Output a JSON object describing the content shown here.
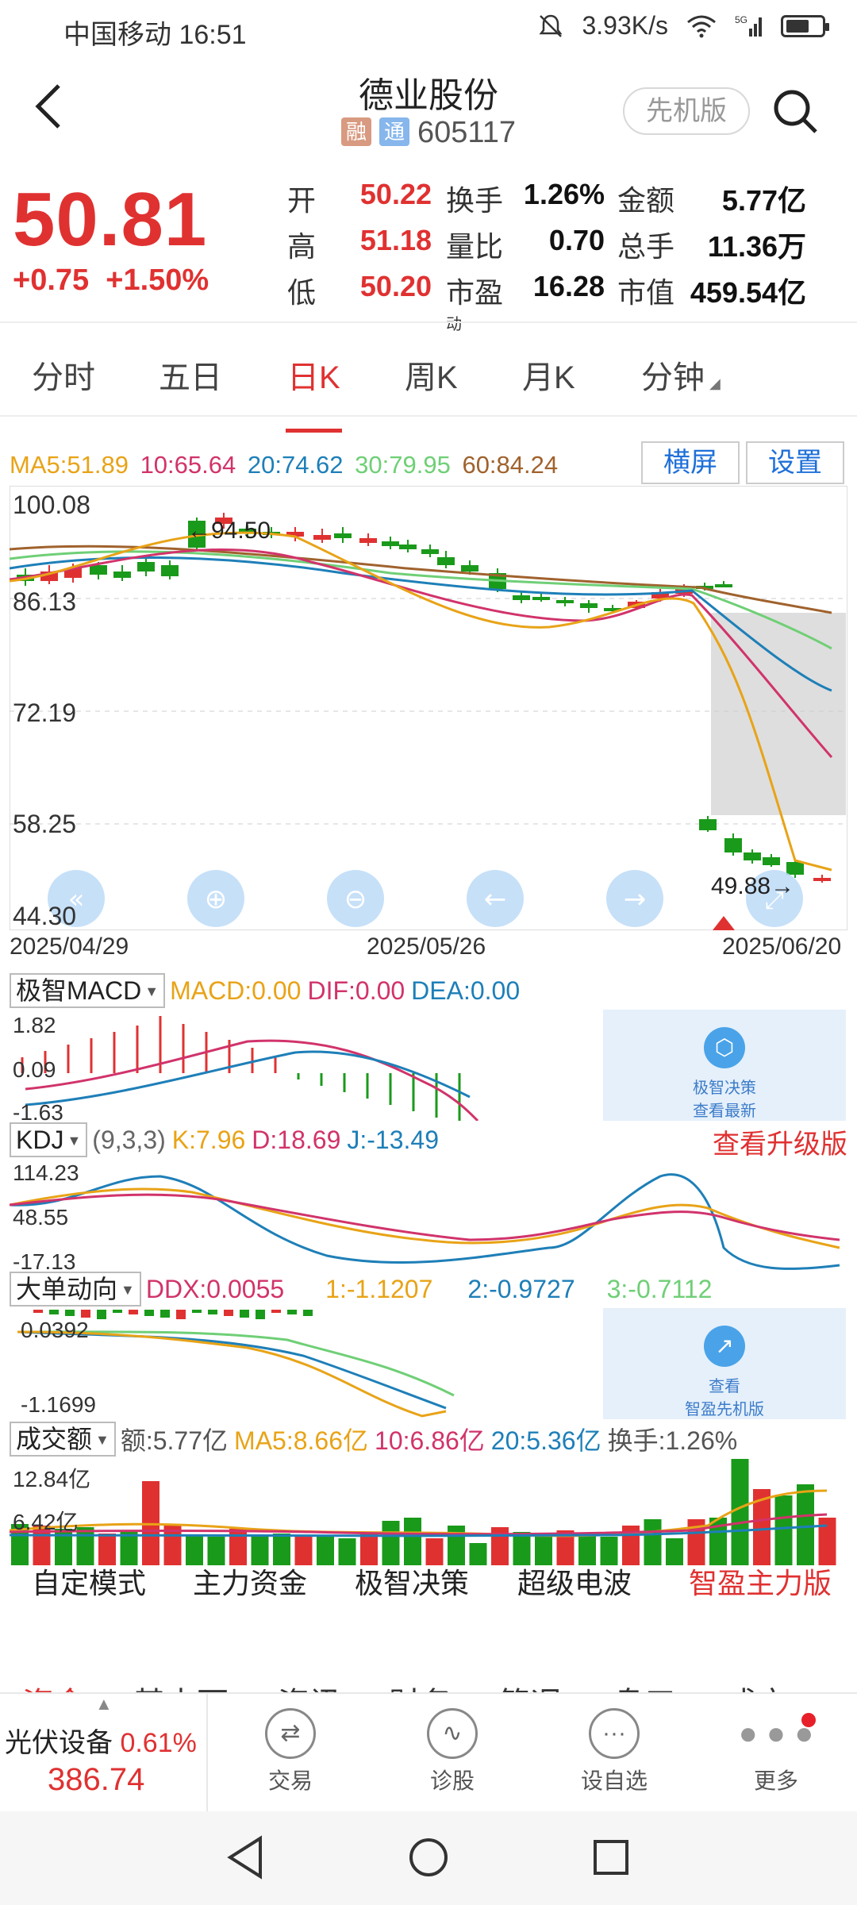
{
  "status": {
    "carrier": "中国移动",
    "time": "16:51",
    "speed": "3.93K/s",
    "network": "5G"
  },
  "header": {
    "name": "德业股份",
    "code": "605117",
    "tag1": "融",
    "tag2": "通",
    "pilot_btn": "先机版"
  },
  "quote": {
    "price": "50.81",
    "change": "+0.75",
    "change_pct": "+1.50%",
    "rows": [
      {
        "k1": "开",
        "v1": "50.22",
        "k2": "换手",
        "v2": "1.26%",
        "k3": "金额",
        "v3": "5.77亿"
      },
      {
        "k1": "高",
        "v1": "51.18",
        "k2": "量比",
        "v2": "0.70",
        "k3": "总手",
        "v3": "11.36万"
      },
      {
        "k1": "低",
        "v1": "50.20",
        "k2": "市盈",
        "k2sup": "动",
        "v2": "16.28",
        "k3": "市值",
        "v3": "459.54亿"
      }
    ]
  },
  "period_tabs": [
    "分时",
    "五日",
    "日K",
    "周K",
    "月K",
    "分钟"
  ],
  "active_tab": "日K",
  "ma": {
    "ma5": "MA5:51.89",
    "ma10": "10:65.64",
    "ma20": "20:74.62",
    "ma30": "30:79.95",
    "ma60": "60:84.24"
  },
  "buttons": {
    "landscape": "横屏",
    "settings": "设置"
  },
  "chart_data": {
    "type": "candlestick",
    "y_ticks": [
      "100.08",
      "86.13",
      "72.19",
      "58.25",
      "44.30"
    ],
    "x_ticks": [
      "2025/04/29",
      "2025/05/26",
      "2025/06/20"
    ],
    "annotations": {
      "high": "94.50",
      "low": "49.88"
    }
  },
  "macd": {
    "name": "极智MACD",
    "macd": "MACD:0.00",
    "dif": "DIF:0.00",
    "dea": "DEA:0.00",
    "y_top": "1.82",
    "y_mid": "0.09",
    "y_bot": "-1.63",
    "promo1": "极智决策",
    "promo2": "查看最新"
  },
  "kdj": {
    "name": "KDJ",
    "params": "(9,3,3)",
    "k": "K:7.96",
    "d": "D:18.69",
    "j": "J:-13.49",
    "upgrade": "查看升级版",
    "y_top": "114.23",
    "y_mid": "48.55",
    "y_bot": "-17.13"
  },
  "ddx": {
    "name": "大单动向",
    "ddx": "DDX:0.0055",
    "s1": "1:-1.1207",
    "s2": "2:-0.9727",
    "s3": "3:-0.7112",
    "y_top": "0.0392",
    "y_bot": "-1.1699",
    "promo1": "查看",
    "promo2": "智盈先机版"
  },
  "vol": {
    "name": "成交额",
    "amount": "额:5.77亿",
    "ma5": "MA5:8.66亿",
    "ma10": "10:6.86亿",
    "ma20": "20:5.36亿",
    "turnover": "换手:1.26%",
    "y_top": "12.84亿",
    "y_mid": "6.42亿"
  },
  "functions": [
    "自定模式",
    "主力资金",
    "极智决策",
    "超级电波",
    "智盈主力版"
  ],
  "subtabs": [
    "资金",
    "基本面",
    "资讯",
    "财务",
    "简况",
    "盘口",
    "成交"
  ],
  "industry": {
    "name": "光伏设备",
    "pct": "0.61%",
    "value": "386.74"
  },
  "nav": [
    {
      "label": "交易",
      "icon": "exchange-icon"
    },
    {
      "label": "诊股",
      "icon": "diagnose-icon"
    },
    {
      "label": "设自选",
      "icon": "add-favorite-icon"
    },
    {
      "label": "更多",
      "icon": "more-icon"
    }
  ]
}
